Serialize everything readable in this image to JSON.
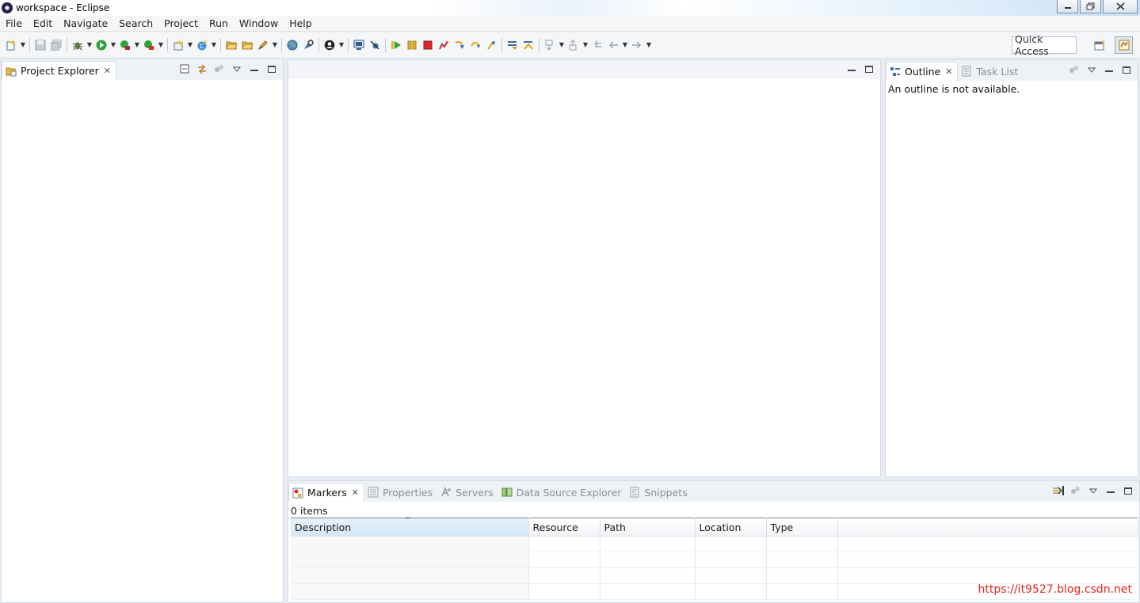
{
  "window": {
    "title": "workspace - Eclipse",
    "controls": {
      "minimize": "▭",
      "restore": "❐",
      "close": "✕"
    }
  },
  "menu": [
    "File",
    "Edit",
    "Navigate",
    "Search",
    "Project",
    "Run",
    "Window",
    "Help"
  ],
  "toolbar": {
    "quick_access": "Quick Access"
  },
  "project_explorer": {
    "tab_label": "Project Explorer"
  },
  "outline": {
    "tabs": [
      {
        "label": "Outline",
        "active": true
      },
      {
        "label": "Task List",
        "active": false
      }
    ],
    "message": "An outline is not available."
  },
  "markers": {
    "tabs": [
      {
        "label": "Markers",
        "active": true,
        "icon": "markers-icon"
      },
      {
        "label": "Properties",
        "active": false,
        "icon": "properties-icon"
      },
      {
        "label": "Servers",
        "active": false,
        "icon": "servers-icon"
      },
      {
        "label": "Data Source Explorer",
        "active": false,
        "icon": "data-source-icon"
      },
      {
        "label": "Snippets",
        "active": false,
        "icon": "snippets-icon"
      }
    ],
    "count": "0 items",
    "columns": [
      "Description",
      "Resource",
      "Path",
      "Location",
      "Type"
    ],
    "sort_indicator": "^"
  },
  "watermark": "https://it9527.blog.csdn.net",
  "colors": {
    "accent_run": "#2fa33a",
    "accent_stop": "#d82a2a",
    "watermark": "#e2261c"
  }
}
